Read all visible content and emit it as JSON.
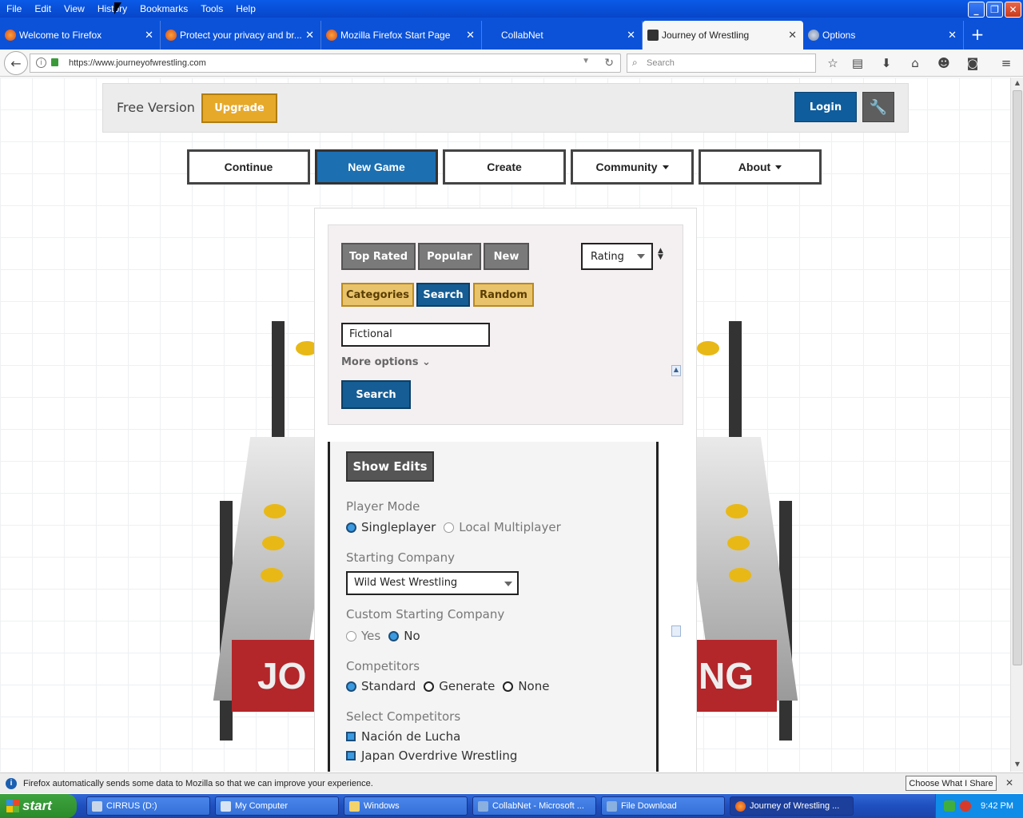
{
  "menubar": {
    "items": [
      "File",
      "Edit",
      "View",
      "History",
      "Bookmarks",
      "Tools",
      "Help"
    ]
  },
  "tabs": [
    {
      "label": "Welcome to Firefox",
      "active": false,
      "icon": "firefox-icon"
    },
    {
      "label": "Protect your privacy and br...",
      "active": false,
      "icon": "firefox-icon"
    },
    {
      "label": "Mozilla Firefox Start Page",
      "active": false,
      "icon": "firefox-icon"
    },
    {
      "label": "CollabNet",
      "active": false,
      "icon": "blank-page-icon"
    },
    {
      "label": "Journey of Wrestling",
      "active": true,
      "icon": "journey-favicon"
    },
    {
      "label": "Options",
      "active": false,
      "icon": "gear-icon"
    }
  ],
  "navbar": {
    "url": "https://www.journeyofwrestling.com",
    "search_placeholder": "Search"
  },
  "site": {
    "free_version": "Free Version",
    "upgrade": "Upgrade",
    "login": "Login",
    "nav": [
      "Continue",
      "New Game",
      "Create",
      "Community",
      "About"
    ]
  },
  "filters": {
    "top_rated": "Top Rated",
    "popular": "Popular",
    "new": "New",
    "sort": "Rating",
    "categories": "Categories",
    "search": "Search",
    "random": "Random",
    "query": "Fictional",
    "more_options": "More options",
    "search_button": "Search"
  },
  "options": {
    "show_edits": "Show Edits",
    "player_mode_label": "Player Mode",
    "singleplayer": "Singleplayer",
    "local_multiplayer": "Local Multiplayer",
    "starting_company_label": "Starting Company",
    "starting_company": "Wild West Wrestling",
    "custom_company_label": "Custom Starting Company",
    "yes": "Yes",
    "no": "No",
    "competitors_label": "Competitors",
    "standard": "Standard",
    "generate": "Generate",
    "none": "None",
    "select_competitors_label": "Select Competitors",
    "competitors": [
      "Nación de Lucha",
      "Japan Overdrive Wrestling"
    ]
  },
  "ring": {
    "left_text": "JO",
    "right_text": "NG"
  },
  "notification": {
    "text": "Firefox automatically sends some data to Mozilla so that we can improve your experience.",
    "button": "Choose What I Share"
  },
  "taskbar": {
    "start": "start",
    "tasks": [
      "CIRRUS (D:)",
      "My Computer",
      "Windows",
      "CollabNet - Microsoft ...",
      "File Download",
      "Journey of Wrestling ..."
    ],
    "time": "9:42 PM"
  },
  "colors": {
    "accent_blue": "#1c6fb0",
    "gold": "#e6a92a",
    "xp_blue": "#0a5ae8"
  }
}
